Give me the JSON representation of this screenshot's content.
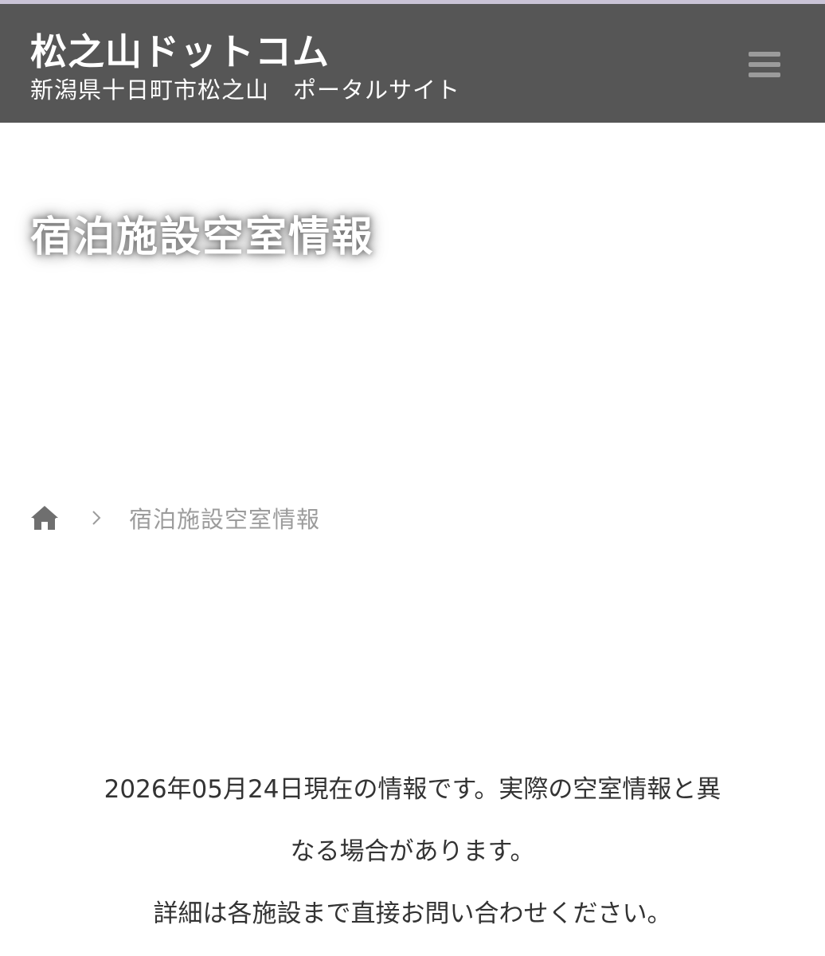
{
  "header": {
    "site_title": "松之山ドットコム",
    "site_subtitle": "新潟県十日町市松之山　ポータルサイト",
    "menu_icon": "hamburger-menu-icon"
  },
  "page": {
    "heading": "宿泊施設空室情報"
  },
  "breadcrumb": {
    "home_icon": "home-icon",
    "separator_icon": "chevron-right-icon",
    "current": "宿泊施設空室情報"
  },
  "notice": {
    "line1": "2026年05月24日現在の情報です。実際の空室情報と異",
    "line2": "なる場合があります。",
    "line3": "詳細は各施設まで直接お問い合わせください。"
  },
  "colors": {
    "header_bg": "#565656",
    "header_text": "#ffffff",
    "breadcrumb_text": "#9c9c9c",
    "body_text": "#333333"
  }
}
